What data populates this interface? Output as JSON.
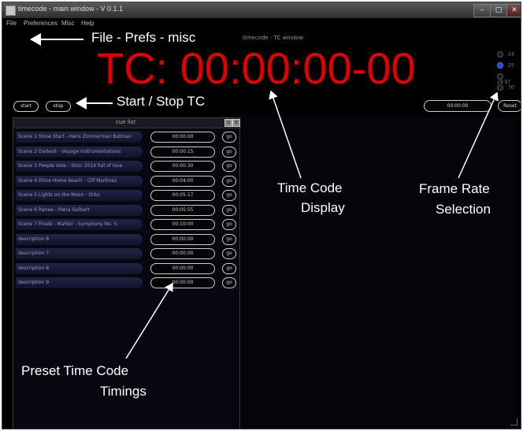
{
  "window": {
    "title": "timecode - main window - V 0.1.1",
    "minimize": "–",
    "maximize": "□",
    "close": "✕"
  },
  "menu": [
    "File",
    "Preferences",
    "Misc",
    "Help"
  ],
  "tab_label": "timecode - TC window",
  "timecode": "TC: 00:00:00-00",
  "frame_rates": {
    "options": [
      "24",
      "25",
      "29.97",
      "30"
    ],
    "selected": "25"
  },
  "buttons": {
    "start": "start",
    "stop": "stop",
    "display_time": "00:00:00",
    "reset": "Reset"
  },
  "cue_list": {
    "title": "cue list",
    "rows": [
      {
        "name": "Scene 1 Show Start - Hans Zimmerman Batman",
        "time": "00:00:00",
        "action": "go"
      },
      {
        "name": "Scene 2 Darkest - Voyage Instrumentations",
        "time": "00:00:15",
        "action": "go"
      },
      {
        "name": "Scene 3 People Vote - Stoic 2014 full of love",
        "time": "00:00:30",
        "action": "go"
      },
      {
        "name": "Scene 4 Drive Home beach - Clif Martinez",
        "time": "00:04:00",
        "action": "go"
      },
      {
        "name": "Scene 5 Lights on the Moon - Orbs",
        "time": "00:05:17",
        "action": "go"
      },
      {
        "name": "Scene 6 Ranea - Petra Gelbart",
        "time": "00:05:55",
        "action": "go"
      },
      {
        "name": "Scene 7 Finale - Mahler - Symphony No. 5",
        "time": "00:10:00",
        "action": "go"
      },
      {
        "name": "description 8",
        "time": "00:00:00",
        "action": "go"
      },
      {
        "name": "description 7",
        "time": "00:00:00",
        "action": "go"
      },
      {
        "name": "description 8",
        "time": "00:00:00",
        "action": "go"
      },
      {
        "name": "description 9",
        "time": "00:00:00",
        "action": "go"
      }
    ]
  },
  "annotations": {
    "menu": "File - Prefs - misc",
    "start_stop": "Start / Stop TC",
    "tc_display_1": "Time Code",
    "tc_display_2": "Display",
    "frame_rate_1": "Frame Rate",
    "frame_rate_2": "Selection",
    "preset_1": "Preset Time Code",
    "preset_2": "Timings"
  }
}
